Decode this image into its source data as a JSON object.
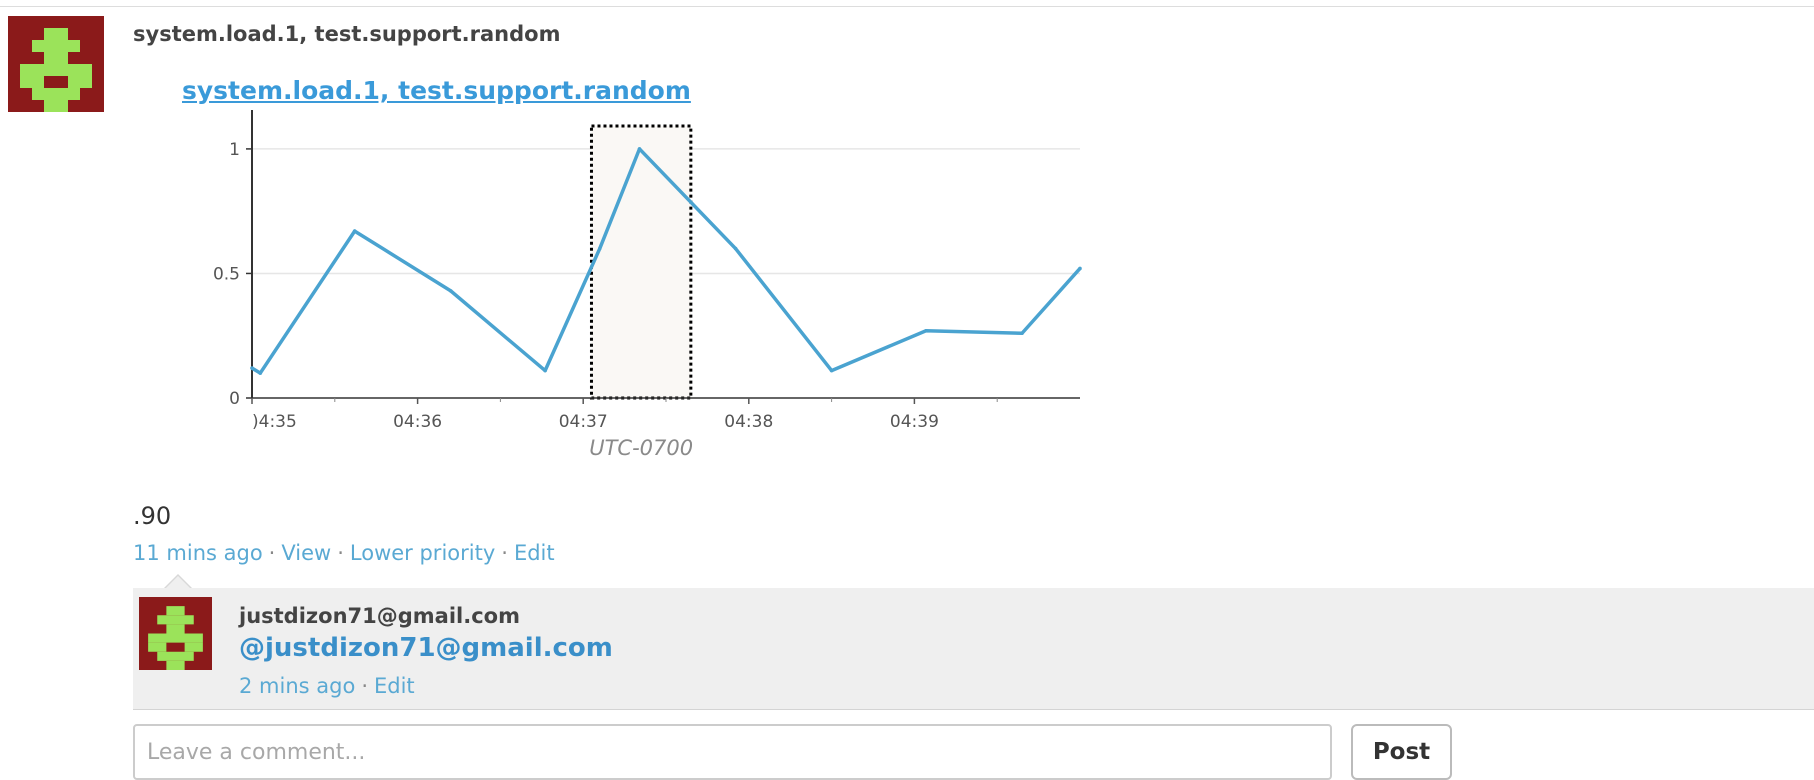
{
  "post": {
    "author": "system.load.1, test.support.random",
    "graph_title": "system.load.1, test.support.random",
    "body": ".90",
    "meta": {
      "time": "11 mins ago",
      "view": "View",
      "lower_priority": "Lower priority",
      "edit": "Edit",
      "separator": "·"
    }
  },
  "chart_data": {
    "type": "line",
    "xlabel": "UTC-0700",
    "ylabel": "",
    "y_ticks": [
      "0",
      "0.5",
      "1"
    ],
    "ylim": [
      0,
      1.1
    ],
    "x_ticks": [
      ")4:35",
      "04:36",
      "04:37",
      "04:38",
      "04:39"
    ],
    "x_tick_positions_min": [
      4.4,
      5.4,
      6.4,
      7.4,
      8.4
    ],
    "xlim_min": [
      4.4,
      9.4
    ],
    "grid": true,
    "highlight_range_min": [
      6.45,
      7.05
    ],
    "series": [
      {
        "color": "#4aa3d0",
        "x_min": [
          4.4,
          4.45,
          5.02,
          5.6,
          6.17,
          6.5,
          6.74,
          7.32,
          7.9,
          8.47,
          9.05,
          9.4
        ],
        "values": [
          0.12,
          0.1,
          0.67,
          0.43,
          0.11,
          0.6,
          1.0,
          0.6,
          0.11,
          0.27,
          0.26,
          0.52
        ]
      }
    ]
  },
  "reply": {
    "author": "justdizon71@gmail.com",
    "mention": "@justdizon71@gmail.com",
    "meta": {
      "time": "2 mins ago",
      "edit": "Edit",
      "separator": "·"
    }
  },
  "comment": {
    "placeholder": "Leave a comment...",
    "post_label": "Post"
  },
  "colors": {
    "link": "#5aa9d3",
    "avatar_bg": "#8b1a1a",
    "avatar_fg": "#9be35a",
    "reply_bg": "#efefef"
  }
}
